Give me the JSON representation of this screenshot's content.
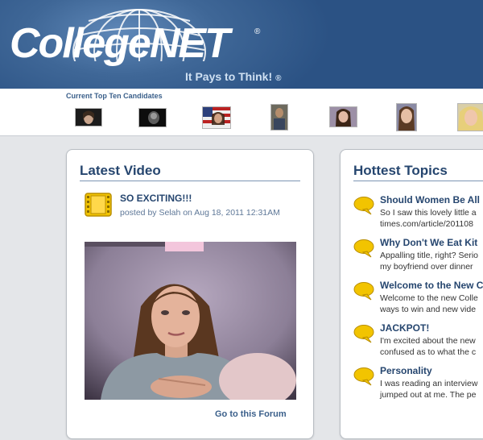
{
  "header": {
    "logo_text": "CollegeNET",
    "logo_registered": "®",
    "tagline": "It Pays to Think!",
    "tagline_registered": "®"
  },
  "candidates": {
    "title": "Current Top Ten Candidates"
  },
  "latest_video": {
    "heading": "Latest Video",
    "title": "SO EXCITING!!!",
    "meta": "posted by Selah on Aug 18, 2011 12:31AM",
    "forum_link": "Go to this Forum"
  },
  "hottest_topics": {
    "heading": "Hottest Topics",
    "topics": [
      {
        "title": "Should Women Be All",
        "line1": "So I saw this lovely little a",
        "line2": "times.com/article/201108"
      },
      {
        "title": "Why Don't We Eat Kit",
        "line1": "Appalling title, right? Serio",
        "line2": "my boyfriend over dinner"
      },
      {
        "title": "Welcome to the New C",
        "line1": "Welcome to the new Colle",
        "line2": "ways to win and new vide"
      },
      {
        "title": "JACKPOT!",
        "line1": "I'm excited about the new",
        "line2": "confused as to what the c"
      },
      {
        "title": "Personality",
        "line1": "I was reading an interview",
        "line2": "jumped out at me. The pe"
      }
    ]
  },
  "colors": {
    "header_blue": "#2b5284",
    "heading_blue": "#26466f",
    "link_blue": "#3a5f8a",
    "icon_yellow": "#f2c400"
  }
}
